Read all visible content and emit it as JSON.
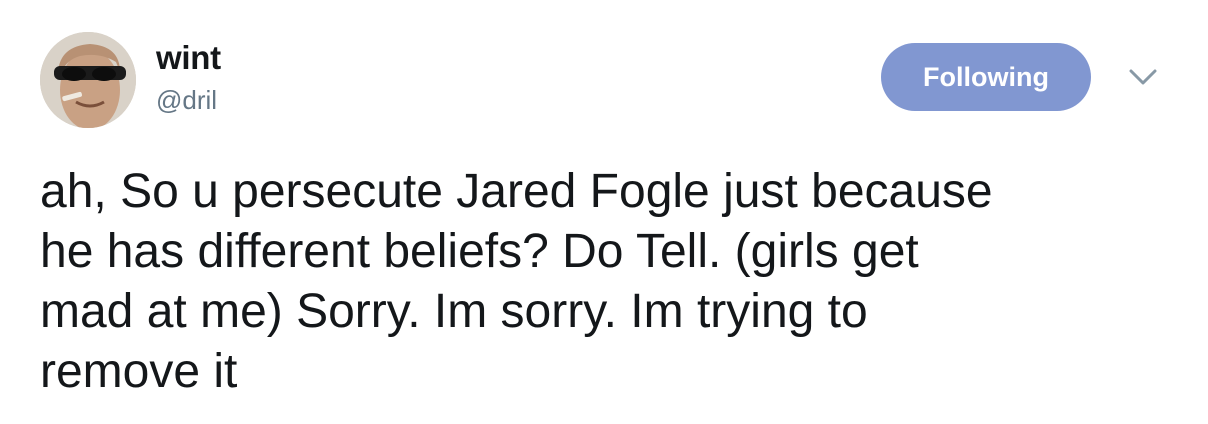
{
  "author": {
    "name": "wint",
    "handle": "@dril",
    "avatar_icon": "profile-photo"
  },
  "actions": {
    "follow_label": "Following",
    "follow_color": "#8197d1",
    "menu_icon": "chevron-down-icon"
  },
  "tweet": {
    "lines": [
      "ah, So u persecute Jared Fogle just because",
      "he has different beliefs? Do Tell. (girls get",
      "mad at me) Sorry. Im sorry. Im trying to",
      "remove it"
    ]
  },
  "colors": {
    "text": "#14171a",
    "secondary_text": "#657786",
    "background": "#ffffff"
  }
}
